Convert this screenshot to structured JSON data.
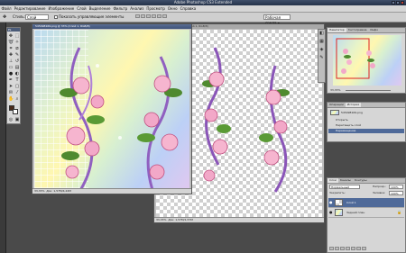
{
  "app": {
    "title": "Adobe Photoshop CS3 Extended"
  },
  "menu": [
    "Файл",
    "Редактирование",
    "Изображение",
    "Слой",
    "Выделение",
    "Фильтр",
    "Анализ",
    "Просмотр",
    "Окно",
    "Справка"
  ],
  "options": {
    "style_label": "Стиль:",
    "style_value": "Слой",
    "show_transform": "Показать управляющие элементы",
    "workspace": "Рабочая среда ▾"
  },
  "doc1": {
    "title": "545498169.png @ 33% (Слой 1, RGB/8)",
    "zoom": "33,33%",
    "status": "Док: 1,57М/4,22М"
  },
  "doc2": {
    "title": "1041498.png @ 33% (Слой 1, RGB/8)",
    "zoom": "33,33%",
    "status": "Док: 1,57М/1,57М"
  },
  "navigator": {
    "tabs": [
      "Навигатор",
      "Гистограмма",
      "Инфо"
    ],
    "zoom": "33,33%"
  },
  "history": {
    "tabs": [
      "Операции",
      "История"
    ],
    "snapshot": "545498169.png",
    "items": [
      "Открыть",
      "Перетащить слой",
      "Перемещение"
    ]
  },
  "layers": {
    "tabs": [
      "Слои",
      "Каналы",
      "Контуры"
    ],
    "blend_mode": "Нормальный",
    "opacity_label": "Непрозр.:",
    "opacity": "100%",
    "lock_label": "Закрепить:",
    "fill_label": "Заливка:",
    "fill": "100%",
    "items": [
      {
        "name": "Слой 1",
        "selected": true
      },
      {
        "name": "Задний план",
        "selected": false
      }
    ]
  },
  "colors": {
    "foreground": "#4a2a1a",
    "background": "#ffffff",
    "accent": "#4f6a99"
  }
}
